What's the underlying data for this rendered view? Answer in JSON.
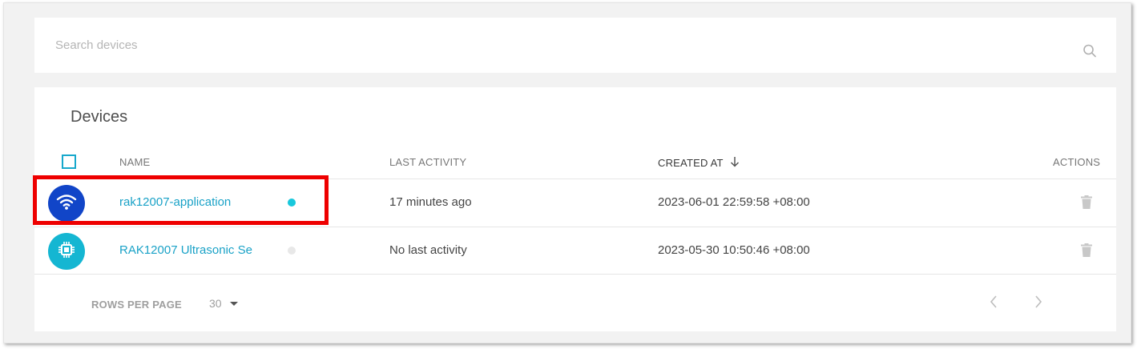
{
  "search": {
    "placeholder": "Search devices",
    "icon": "search-icon"
  },
  "devices": {
    "title": "Devices",
    "columns": {
      "name": "NAME",
      "last_activity": "LAST ACTIVITY",
      "created_at": "CREATED AT",
      "actions": "ACTIONS"
    },
    "sort": {
      "column": "created_at",
      "direction": "descending"
    },
    "rows": [
      {
        "name": "rak12007-application",
        "status": "online",
        "status_color": "#18c8dc",
        "avatar_icon": "wifi-icon",
        "avatar_color": "#1145c8",
        "last_activity": "17 minutes ago",
        "created_at": "2023-06-01 22:59:58 +08:00"
      },
      {
        "name": "RAK12007 Ultrasonic Se",
        "status": "offline",
        "status_color": "#e8e8e8",
        "avatar_icon": "chip-icon",
        "avatar_color": "#14b6d2",
        "last_activity": "No last activity",
        "created_at": "2023-05-30 10:50:46 +08:00"
      }
    ]
  },
  "pagination": {
    "rows_per_page_label": "ROWS PER PAGE",
    "rows_per_page": "30",
    "prev_icon": "chevron-left-icon",
    "next_icon": "chevron-right-icon"
  },
  "colors": {
    "accent": "#1aa2c7",
    "highlight": "#ee0000"
  }
}
